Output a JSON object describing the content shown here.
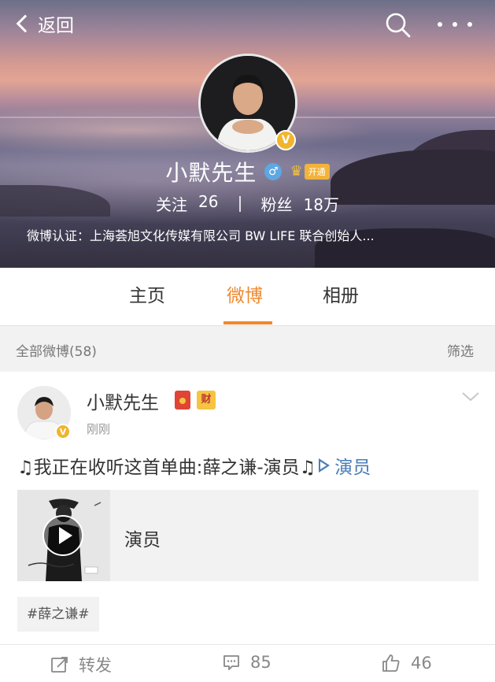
{
  "nav": {
    "back_label": "返回"
  },
  "profile": {
    "name": "小默先生",
    "vip_label": "开通",
    "following_label": "关注",
    "following_count": "26",
    "followers_label": "粉丝",
    "followers_count": "18万",
    "verification": "微博认证：上海荟旭文化传媒有限公司 BW LIFE 联合创始人..."
  },
  "tabs": [
    {
      "label": "主页",
      "active": false
    },
    {
      "label": "微博",
      "active": true
    },
    {
      "label": "相册",
      "active": false
    }
  ],
  "filter": {
    "label": "全部微博(58)",
    "button": "筛选"
  },
  "post": {
    "author": "小默先生",
    "cai_badge": "财",
    "time": "刚刚",
    "text": "♫我正在收听这首单曲:薛之谦-演员♫",
    "song_link": "演员",
    "music_card_title": "演员",
    "topic": "#薛之谦#",
    "actions": {
      "repost_label": "转发",
      "comment_count": "85",
      "like_count": "46"
    }
  },
  "colors": {
    "accent_orange": "#f0892f",
    "link_blue": "#4a7db8",
    "verified_gold": "#f0b52d"
  },
  "icons": [
    "back-chevron-icon",
    "search-icon",
    "more-icon",
    "verified-icon",
    "male-icon",
    "vip-crown-icon",
    "redpacket-icon",
    "chevron-down-icon",
    "play-icon",
    "repost-icon",
    "comment-icon",
    "like-icon"
  ]
}
